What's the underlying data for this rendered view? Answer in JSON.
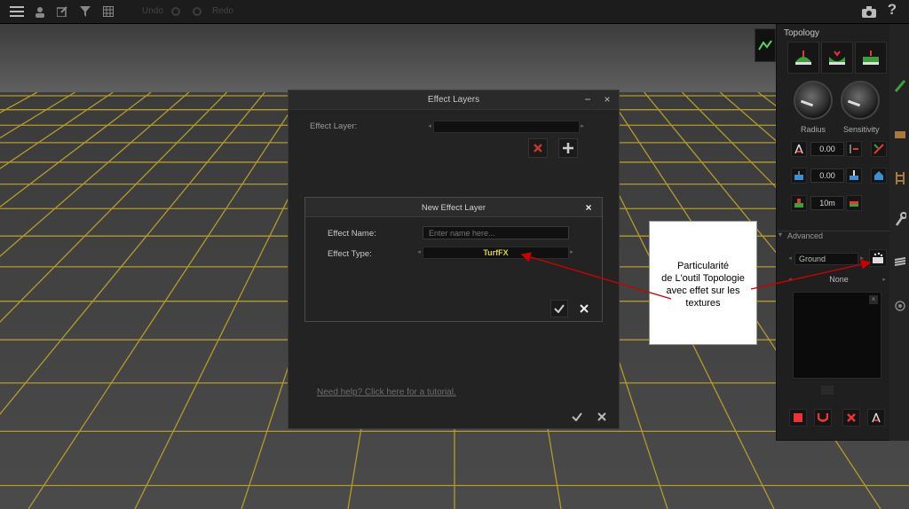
{
  "toolbar": {
    "menu_icon": "hamburger-icon",
    "undo_label": "Undo",
    "redo_label": "Redo"
  },
  "effect_layers": {
    "title": "Effect Layers",
    "effect_layer_label": "Effect Layer:",
    "effect_layer_value": "",
    "help_link": "Need help? Click here for a tutorial."
  },
  "new_effect_layer": {
    "title": "New Effect Layer",
    "effect_name_label": "Effect Name:",
    "effect_name_placeholder": "Enter name here...",
    "effect_type_label": "Effect Type:",
    "effect_type_value": "TurfFX"
  },
  "topology": {
    "title": "Topology",
    "radius_label": "Radius",
    "sensitivity_label": "Sensitivity",
    "value_1": "0.00",
    "value_2": "0.00",
    "value_3": "10m",
    "advanced_label": "Advanced",
    "ground_value": "Ground",
    "none_value": "None"
  },
  "callout": {
    "text": "Particularité\nde L'outil Topologie\navec effet sur les\ntextures"
  },
  "colors": {
    "grid_line": "#b39b2a",
    "turf_value": "#d7d34a",
    "arrow": "#cc0000"
  }
}
